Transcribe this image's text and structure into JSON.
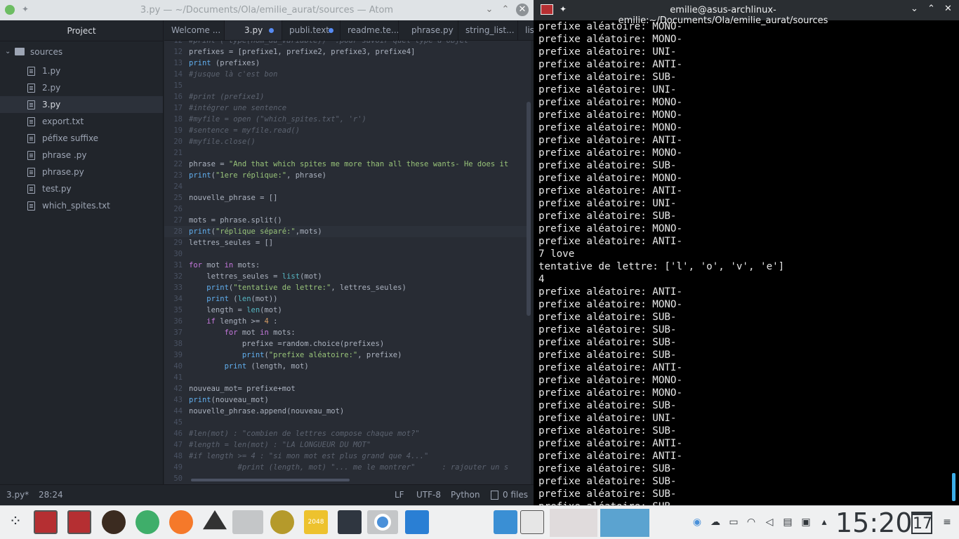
{
  "atom": {
    "title": "3.py — ~/Documents/Ola/emilie_aurat/sources — Atom",
    "project_label": "Project",
    "tree": {
      "root": "sources",
      "files": [
        "1.py",
        "2.py",
        "3.py",
        "export.txt",
        "péfixe suffixe",
        "phrase .py",
        "phrase.py",
        "test.py",
        "which_spites.txt"
      ],
      "selected": "3.py"
    },
    "tabs": [
      {
        "label": "Welcome ..."
      },
      {
        "label": "3.py"
      },
      {
        "label": "publi.text"
      },
      {
        "label": "readme.te..."
      },
      {
        "label": "phrase.py"
      },
      {
        "label": "string_list..."
      },
      {
        "label": "lis"
      }
    ],
    "lines": [
      {
        "n": "12",
        "t": "#print ( type(nom_du_variable))  :pour savoir quel type d'objet"
      },
      {
        "n": "12",
        "t": "prefixes = [prefixe1, prefixe2, prefixe3, prefixe4]"
      },
      {
        "n": "13",
        "t": "print (prefixes)"
      },
      {
        "n": "14",
        "t": "#jusque là c'est bon"
      },
      {
        "n": "15",
        "t": ""
      },
      {
        "n": "16",
        "t": "#print (prefixe1)"
      },
      {
        "n": "17",
        "t": "#intégrer une sentence"
      },
      {
        "n": "18",
        "t": "#myfile = open (\"which_spites.txt\", 'r')"
      },
      {
        "n": "19",
        "t": "#sentence = myfile.read()"
      },
      {
        "n": "20",
        "t": "#myfile.close()"
      },
      {
        "n": "21",
        "t": ""
      },
      {
        "n": "22",
        "t": "phrase = \"And that which spites me more than all these wants- He does it"
      },
      {
        "n": "23",
        "t": "print(\"1ere réplique:\", phrase)"
      },
      {
        "n": "24",
        "t": ""
      },
      {
        "n": "25",
        "t": "nouvelle_phrase = []"
      },
      {
        "n": "26",
        "t": ""
      },
      {
        "n": "27",
        "t": "mots = phrase.split()"
      },
      {
        "n": "28",
        "t": "print(\"réplique séparé:\",mots)"
      },
      {
        "n": "29",
        "t": "lettres_seules = []"
      },
      {
        "n": "30",
        "t": ""
      },
      {
        "n": "31",
        "t": "for mot in mots:"
      },
      {
        "n": "32",
        "t": "    lettres_seules = list(mot)"
      },
      {
        "n": "33",
        "t": "    print(\"tentative de lettre:\", lettres_seules)"
      },
      {
        "n": "34",
        "t": "    print (len(mot))"
      },
      {
        "n": "35",
        "t": "    length = len(mot)"
      },
      {
        "n": "36",
        "t": "    if length >= 4 :"
      },
      {
        "n": "37",
        "t": "        for mot in mots:"
      },
      {
        "n": "38",
        "t": "            prefixe =random.choice(prefixes)"
      },
      {
        "n": "39",
        "t": "            print(\"prefixe aléatoire:\", prefixe)"
      },
      {
        "n": "40",
        "t": "        print (length, mot)"
      },
      {
        "n": "41",
        "t": ""
      },
      {
        "n": "42",
        "t": "nouveau_mot= prefixe+mot"
      },
      {
        "n": "43",
        "t": "print(nouveau_mot)"
      },
      {
        "n": "44",
        "t": "nouvelle_phrase.append(nouveau_mot)"
      },
      {
        "n": "45",
        "t": ""
      },
      {
        "n": "46",
        "t": "#len(mot) : \"combien de lettres compose chaque mot?\""
      },
      {
        "n": "47",
        "t": "#length = len(mot) : \"LA LONGUEUR DU MOT\""
      },
      {
        "n": "48",
        "t": "#if length >= 4 : \"si mon mot est plus grand que 4...\""
      },
      {
        "n": "49",
        "t": "           #print (length, mot) \"... me le montrer\"      : rajouter un s"
      },
      {
        "n": "50",
        "t": ""
      }
    ],
    "status": {
      "file": "3.py*",
      "cursor": "28:24",
      "eol": "LF",
      "encoding": "UTF-8",
      "grammar": "Python",
      "files": "0 files"
    }
  },
  "terminal": {
    "title": "emilie@asus-archlinux-emilie:~/Documents/Ola/emilie_aurat/sources",
    "lines": [
      "prefixe aléatoire: MONO-",
      "prefixe aléatoire: MONO-",
      "prefixe aléatoire: UNI-",
      "prefixe aléatoire: ANTI-",
      "prefixe aléatoire: SUB-",
      "prefixe aléatoire: UNI-",
      "prefixe aléatoire: MONO-",
      "prefixe aléatoire: MONO-",
      "prefixe aléatoire: MONO-",
      "prefixe aléatoire: ANTI-",
      "prefixe aléatoire: MONO-",
      "prefixe aléatoire: SUB-",
      "prefixe aléatoire: MONO-",
      "prefixe aléatoire: ANTI-",
      "prefixe aléatoire: UNI-",
      "prefixe aléatoire: SUB-",
      "prefixe aléatoire: MONO-",
      "prefixe aléatoire: ANTI-",
      "7 love",
      "tentative de lettre: ['l', 'o', 'v', 'e']",
      "4",
      "prefixe aléatoire: ANTI-",
      "prefixe aléatoire: MONO-",
      "prefixe aléatoire: SUB-",
      "prefixe aléatoire: SUB-",
      "prefixe aléatoire: SUB-",
      "prefixe aléatoire: SUB-",
      "prefixe aléatoire: ANTI-",
      "prefixe aléatoire: MONO-",
      "prefixe aléatoire: MONO-",
      "prefixe aléatoire: SUB-",
      "prefixe aléatoire: UNI-",
      "prefixe aléatoire: SUB-",
      "prefixe aléatoire: ANTI-",
      "prefixe aléatoire: ANTI-",
      "prefixe aléatoire: SUB-",
      "prefixe aléatoire: SUB-",
      "prefixe aléatoire: SUB-",
      "prefixe aléatoire: SUB-"
    ]
  },
  "taskbar": {
    "clock": "15:20",
    "date_day": "17",
    "tile_2048": "2048",
    "apps": [
      "application-launcher-icon",
      "terminal-icon",
      "terminal-icon-2",
      "bonfire-icon",
      "atom-icon",
      "blender-icon",
      "inkscape-icon",
      "gimp-icon",
      "game-icon",
      "game-2048-icon",
      "task-icon",
      "chromium-icon",
      "files-icon",
      "spacer",
      "screenshot-tool-icon",
      "task-manager-icon"
    ],
    "tray": [
      "chromium-tray-icon",
      "cloud-icon",
      "battery-icon",
      "wifi-icon",
      "volume-icon",
      "clipboard-icon",
      "lock-icon",
      "tray-expand-icon"
    ]
  },
  "colors": {
    "accent": "#568af2",
    "kde_blue": "#3daee9",
    "close_red": "#da4453"
  }
}
